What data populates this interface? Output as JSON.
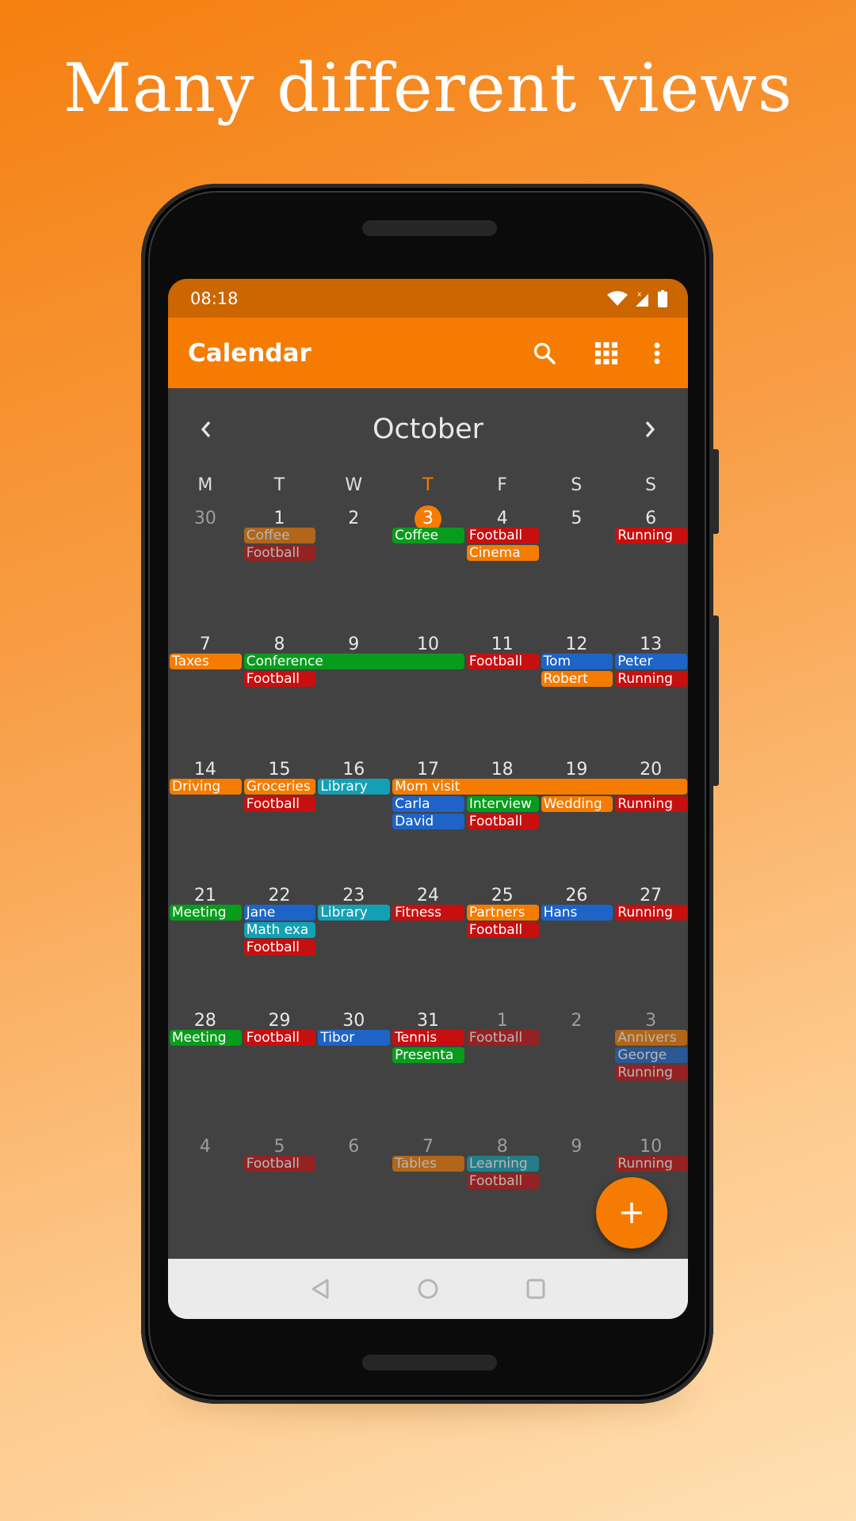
{
  "headline": "Many different views",
  "status_bar": {
    "time": "08:18",
    "icons": [
      "wifi-icon",
      "signal-icon",
      "battery-icon"
    ]
  },
  "app_bar": {
    "title": "Calendar",
    "actions": [
      {
        "name": "search-icon",
        "label": "Search"
      },
      {
        "name": "grid-view-icon",
        "label": "Change view"
      },
      {
        "name": "more-vert-icon",
        "label": "More options"
      }
    ]
  },
  "month_nav": {
    "month": "October",
    "prev_icon": "chevron-left-icon",
    "next_icon": "chevron-right-icon"
  },
  "weekdays": [
    {
      "label": "M",
      "today": false
    },
    {
      "label": "T",
      "today": false
    },
    {
      "label": "W",
      "today": false
    },
    {
      "label": "T",
      "today": true
    },
    {
      "label": "F",
      "today": false
    },
    {
      "label": "S",
      "today": false
    },
    {
      "label": "S",
      "today": false
    }
  ],
  "colors": {
    "accent": "#f57c00",
    "status_bar": "#cc6600",
    "background": "#424242",
    "orange": "#f57c00",
    "green": "#089c1c",
    "red": "#c80f0f",
    "blue": "#1e64c8",
    "teal": "#14a0b4"
  },
  "weeks": [
    {
      "days": [
        {
          "num": "30",
          "other": true
        },
        {
          "num": "1"
        },
        {
          "num": "2"
        },
        {
          "num": "3",
          "today": true
        },
        {
          "num": "4"
        },
        {
          "num": "5"
        },
        {
          "num": "6"
        }
      ],
      "events": [
        {
          "title": "Coffee",
          "start": 1,
          "span": 1,
          "row": 0,
          "color": "orange",
          "dim": true
        },
        {
          "title": "Football",
          "start": 1,
          "span": 1,
          "row": 1,
          "color": "red",
          "dim": true
        },
        {
          "title": "Coffee",
          "start": 3,
          "span": 1,
          "row": 0,
          "color": "green"
        },
        {
          "title": "Football",
          "start": 4,
          "span": 1,
          "row": 0,
          "color": "red"
        },
        {
          "title": "Cinema",
          "start": 4,
          "span": 1,
          "row": 1,
          "color": "orange"
        },
        {
          "title": "Running",
          "start": 6,
          "span": 1,
          "row": 0,
          "color": "red"
        }
      ]
    },
    {
      "days": [
        {
          "num": "7"
        },
        {
          "num": "8"
        },
        {
          "num": "9"
        },
        {
          "num": "10"
        },
        {
          "num": "11"
        },
        {
          "num": "12"
        },
        {
          "num": "13"
        }
      ],
      "events": [
        {
          "title": "Taxes",
          "start": 0,
          "span": 1,
          "row": 0,
          "color": "orange"
        },
        {
          "title": "Conference",
          "start": 1,
          "span": 3,
          "row": 0,
          "color": "green"
        },
        {
          "title": "Football",
          "start": 1,
          "span": 1,
          "row": 1,
          "color": "red"
        },
        {
          "title": "Football",
          "start": 4,
          "span": 1,
          "row": 0,
          "color": "red"
        },
        {
          "title": "Tom",
          "start": 5,
          "span": 1,
          "row": 0,
          "color": "blue"
        },
        {
          "title": "Robert",
          "start": 5,
          "span": 1,
          "row": 1,
          "color": "orange"
        },
        {
          "title": "Peter",
          "start": 6,
          "span": 1,
          "row": 0,
          "color": "blue"
        },
        {
          "title": "Running",
          "start": 6,
          "span": 1,
          "row": 1,
          "color": "red"
        }
      ]
    },
    {
      "days": [
        {
          "num": "14"
        },
        {
          "num": "15"
        },
        {
          "num": "16"
        },
        {
          "num": "17"
        },
        {
          "num": "18"
        },
        {
          "num": "19"
        },
        {
          "num": "20"
        }
      ],
      "events": [
        {
          "title": "Driving",
          "start": 0,
          "span": 1,
          "row": 0,
          "color": "orange"
        },
        {
          "title": "Groceries",
          "start": 1,
          "span": 1,
          "row": 0,
          "color": "orange"
        },
        {
          "title": "Football",
          "start": 1,
          "span": 1,
          "row": 1,
          "color": "red"
        },
        {
          "title": "Library",
          "start": 2,
          "span": 1,
          "row": 0,
          "color": "teal"
        },
        {
          "title": "Mom visit",
          "start": 3,
          "span": 4,
          "row": 0,
          "color": "orange"
        },
        {
          "title": "Carla",
          "start": 3,
          "span": 1,
          "row": 1,
          "color": "blue"
        },
        {
          "title": "David",
          "start": 3,
          "span": 1,
          "row": 2,
          "color": "blue"
        },
        {
          "title": "Interview",
          "start": 4,
          "span": 1,
          "row": 1,
          "color": "green"
        },
        {
          "title": "Football",
          "start": 4,
          "span": 1,
          "row": 2,
          "color": "red"
        },
        {
          "title": "Wedding",
          "start": 5,
          "span": 1,
          "row": 1,
          "color": "orange"
        },
        {
          "title": "Running",
          "start": 6,
          "span": 1,
          "row": 1,
          "color": "red"
        }
      ]
    },
    {
      "days": [
        {
          "num": "21"
        },
        {
          "num": "22"
        },
        {
          "num": "23"
        },
        {
          "num": "24"
        },
        {
          "num": "25"
        },
        {
          "num": "26"
        },
        {
          "num": "27"
        }
      ],
      "events": [
        {
          "title": "Meeting",
          "start": 0,
          "span": 1,
          "row": 0,
          "color": "green"
        },
        {
          "title": "Jane",
          "start": 1,
          "span": 1,
          "row": 0,
          "color": "blue"
        },
        {
          "title": "Math exa",
          "start": 1,
          "span": 1,
          "row": 1,
          "color": "teal"
        },
        {
          "title": "Football",
          "start": 1,
          "span": 1,
          "row": 2,
          "color": "red"
        },
        {
          "title": "Library",
          "start": 2,
          "span": 1,
          "row": 0,
          "color": "teal"
        },
        {
          "title": "Fitness",
          "start": 3,
          "span": 1,
          "row": 0,
          "color": "red"
        },
        {
          "title": "Partners",
          "start": 4,
          "span": 1,
          "row": 0,
          "color": "orange"
        },
        {
          "title": "Football",
          "start": 4,
          "span": 1,
          "row": 1,
          "color": "red"
        },
        {
          "title": "Hans",
          "start": 5,
          "span": 1,
          "row": 0,
          "color": "blue"
        },
        {
          "title": "Running",
          "start": 6,
          "span": 1,
          "row": 0,
          "color": "red"
        }
      ]
    },
    {
      "days": [
        {
          "num": "28"
        },
        {
          "num": "29"
        },
        {
          "num": "30"
        },
        {
          "num": "31"
        },
        {
          "num": "1",
          "other": true
        },
        {
          "num": "2",
          "other": true
        },
        {
          "num": "3",
          "other": true
        }
      ],
      "events": [
        {
          "title": "Meeting",
          "start": 0,
          "span": 1,
          "row": 0,
          "color": "green"
        },
        {
          "title": "Football",
          "start": 1,
          "span": 1,
          "row": 0,
          "color": "red"
        },
        {
          "title": "Tibor",
          "start": 2,
          "span": 1,
          "row": 0,
          "color": "blue"
        },
        {
          "title": "Tennis",
          "start": 3,
          "span": 1,
          "row": 0,
          "color": "red"
        },
        {
          "title": "Presenta",
          "start": 3,
          "span": 1,
          "row": 1,
          "color": "green"
        },
        {
          "title": "Football",
          "start": 4,
          "span": 1,
          "row": 0,
          "color": "red",
          "dim": true
        },
        {
          "title": "Annivers",
          "start": 6,
          "span": 1,
          "row": 0,
          "color": "orange",
          "dim": true
        },
        {
          "title": "George",
          "start": 6,
          "span": 1,
          "row": 1,
          "color": "blue",
          "dim": true
        },
        {
          "title": "Running",
          "start": 6,
          "span": 1,
          "row": 2,
          "color": "red",
          "dim": true
        }
      ]
    },
    {
      "days": [
        {
          "num": "4",
          "other": true
        },
        {
          "num": "5",
          "other": true
        },
        {
          "num": "6",
          "other": true
        },
        {
          "num": "7",
          "other": true
        },
        {
          "num": "8",
          "other": true
        },
        {
          "num": "9",
          "other": true
        },
        {
          "num": "10",
          "other": true
        }
      ],
      "events": [
        {
          "title": "Football",
          "start": 1,
          "span": 1,
          "row": 0,
          "color": "red",
          "dim": true
        },
        {
          "title": "Tables",
          "start": 3,
          "span": 1,
          "row": 0,
          "color": "orange",
          "dim": true
        },
        {
          "title": "Learning",
          "start": 4,
          "span": 1,
          "row": 0,
          "color": "teal",
          "dim": true
        },
        {
          "title": "Football",
          "start": 4,
          "span": 1,
          "row": 1,
          "color": "red",
          "dim": true
        },
        {
          "title": "Running",
          "start": 6,
          "span": 1,
          "row": 0,
          "color": "red",
          "dim": true
        }
      ]
    }
  ],
  "fab": {
    "label": "Add event",
    "icon": "plus-icon"
  },
  "nav_bar": {
    "buttons": [
      "back-icon",
      "home-icon",
      "recents-icon"
    ]
  }
}
